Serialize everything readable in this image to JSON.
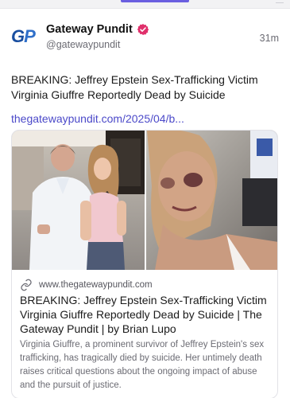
{
  "account": {
    "name": "Gateway Pundit",
    "handle": "@gatewaypundit",
    "timestamp": "31m",
    "avatar_letters_1": "G",
    "avatar_letters_2": "P",
    "verified_icon": "verified-badge-icon"
  },
  "post": {
    "text": "BREAKING: Jeffrey Epstein Sex-Trafficking Victim Virginia Giuffre Reportedly Dead by Suicide",
    "link": "thegatewaypundit.com/2025/04/b..."
  },
  "embed": {
    "domain": "www.thegatewaypundit.com",
    "title": "BREAKING: Jeffrey Epstein Sex-Trafficking Victim Virginia Giuffre Reportedly Dead by Suicide | The Gateway Pundit | by Brian Lupo",
    "description": "Virginia Giuffre, a prominent survivor of Jeffrey Epstein's sex trafficking, has tragically died by suicide. Her untimely death raises critical questions about the ongoing impact of abuse and the pursuit of justice.",
    "link_icon": "link-icon"
  },
  "colors": {
    "accent": "#6a5ee0",
    "link": "#4b49c9",
    "verified": "#e0306b"
  }
}
